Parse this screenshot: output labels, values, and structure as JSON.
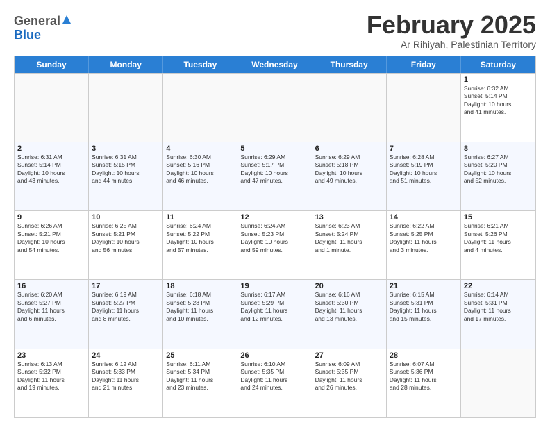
{
  "logo": {
    "general": "General",
    "blue": "Blue"
  },
  "header": {
    "month": "February 2025",
    "location": "Ar Rihiyah, Palestinian Territory"
  },
  "days": [
    "Sunday",
    "Monday",
    "Tuesday",
    "Wednesday",
    "Thursday",
    "Friday",
    "Saturday"
  ],
  "weeks": [
    [
      {
        "day": "",
        "info": ""
      },
      {
        "day": "",
        "info": ""
      },
      {
        "day": "",
        "info": ""
      },
      {
        "day": "",
        "info": ""
      },
      {
        "day": "",
        "info": ""
      },
      {
        "day": "",
        "info": ""
      },
      {
        "day": "1",
        "info": "Sunrise: 6:32 AM\nSunset: 5:14 PM\nDaylight: 10 hours\nand 41 minutes."
      }
    ],
    [
      {
        "day": "2",
        "info": "Sunrise: 6:31 AM\nSunset: 5:14 PM\nDaylight: 10 hours\nand 43 minutes."
      },
      {
        "day": "3",
        "info": "Sunrise: 6:31 AM\nSunset: 5:15 PM\nDaylight: 10 hours\nand 44 minutes."
      },
      {
        "day": "4",
        "info": "Sunrise: 6:30 AM\nSunset: 5:16 PM\nDaylight: 10 hours\nand 46 minutes."
      },
      {
        "day": "5",
        "info": "Sunrise: 6:29 AM\nSunset: 5:17 PM\nDaylight: 10 hours\nand 47 minutes."
      },
      {
        "day": "6",
        "info": "Sunrise: 6:29 AM\nSunset: 5:18 PM\nDaylight: 10 hours\nand 49 minutes."
      },
      {
        "day": "7",
        "info": "Sunrise: 6:28 AM\nSunset: 5:19 PM\nDaylight: 10 hours\nand 51 minutes."
      },
      {
        "day": "8",
        "info": "Sunrise: 6:27 AM\nSunset: 5:20 PM\nDaylight: 10 hours\nand 52 minutes."
      }
    ],
    [
      {
        "day": "9",
        "info": "Sunrise: 6:26 AM\nSunset: 5:21 PM\nDaylight: 10 hours\nand 54 minutes."
      },
      {
        "day": "10",
        "info": "Sunrise: 6:25 AM\nSunset: 5:21 PM\nDaylight: 10 hours\nand 56 minutes."
      },
      {
        "day": "11",
        "info": "Sunrise: 6:24 AM\nSunset: 5:22 PM\nDaylight: 10 hours\nand 57 minutes."
      },
      {
        "day": "12",
        "info": "Sunrise: 6:24 AM\nSunset: 5:23 PM\nDaylight: 10 hours\nand 59 minutes."
      },
      {
        "day": "13",
        "info": "Sunrise: 6:23 AM\nSunset: 5:24 PM\nDaylight: 11 hours\nand 1 minute."
      },
      {
        "day": "14",
        "info": "Sunrise: 6:22 AM\nSunset: 5:25 PM\nDaylight: 11 hours\nand 3 minutes."
      },
      {
        "day": "15",
        "info": "Sunrise: 6:21 AM\nSunset: 5:26 PM\nDaylight: 11 hours\nand 4 minutes."
      }
    ],
    [
      {
        "day": "16",
        "info": "Sunrise: 6:20 AM\nSunset: 5:27 PM\nDaylight: 11 hours\nand 6 minutes."
      },
      {
        "day": "17",
        "info": "Sunrise: 6:19 AM\nSunset: 5:27 PM\nDaylight: 11 hours\nand 8 minutes."
      },
      {
        "day": "18",
        "info": "Sunrise: 6:18 AM\nSunset: 5:28 PM\nDaylight: 11 hours\nand 10 minutes."
      },
      {
        "day": "19",
        "info": "Sunrise: 6:17 AM\nSunset: 5:29 PM\nDaylight: 11 hours\nand 12 minutes."
      },
      {
        "day": "20",
        "info": "Sunrise: 6:16 AM\nSunset: 5:30 PM\nDaylight: 11 hours\nand 13 minutes."
      },
      {
        "day": "21",
        "info": "Sunrise: 6:15 AM\nSunset: 5:31 PM\nDaylight: 11 hours\nand 15 minutes."
      },
      {
        "day": "22",
        "info": "Sunrise: 6:14 AM\nSunset: 5:31 PM\nDaylight: 11 hours\nand 17 minutes."
      }
    ],
    [
      {
        "day": "23",
        "info": "Sunrise: 6:13 AM\nSunset: 5:32 PM\nDaylight: 11 hours\nand 19 minutes."
      },
      {
        "day": "24",
        "info": "Sunrise: 6:12 AM\nSunset: 5:33 PM\nDaylight: 11 hours\nand 21 minutes."
      },
      {
        "day": "25",
        "info": "Sunrise: 6:11 AM\nSunset: 5:34 PM\nDaylight: 11 hours\nand 23 minutes."
      },
      {
        "day": "26",
        "info": "Sunrise: 6:10 AM\nSunset: 5:35 PM\nDaylight: 11 hours\nand 24 minutes."
      },
      {
        "day": "27",
        "info": "Sunrise: 6:09 AM\nSunset: 5:35 PM\nDaylight: 11 hours\nand 26 minutes."
      },
      {
        "day": "28",
        "info": "Sunrise: 6:07 AM\nSunset: 5:36 PM\nDaylight: 11 hours\nand 28 minutes."
      },
      {
        "day": "",
        "info": ""
      }
    ]
  ]
}
